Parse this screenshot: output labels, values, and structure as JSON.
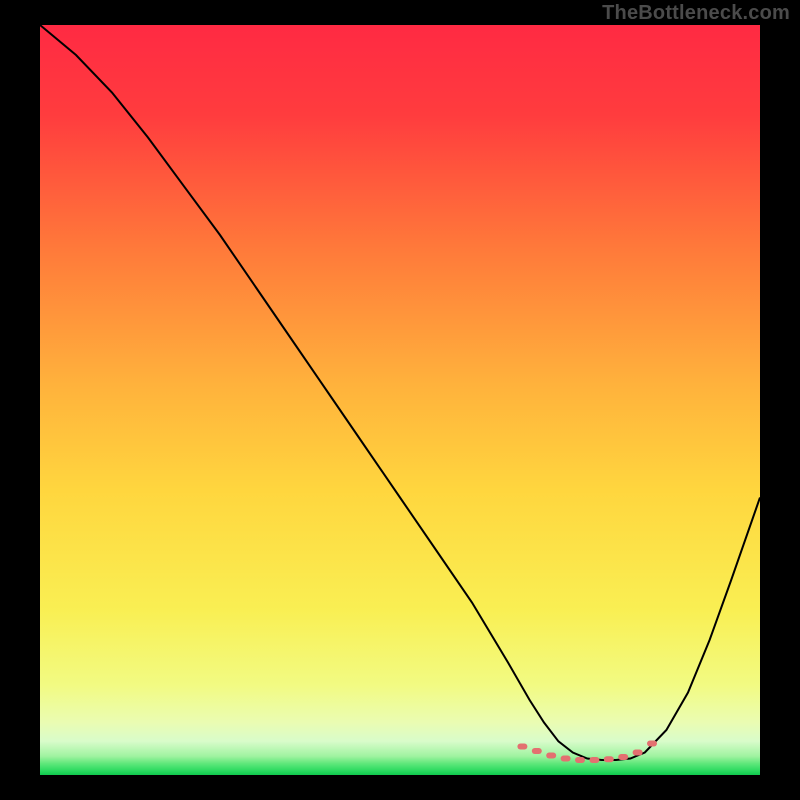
{
  "watermark": "TheBottleneck.com",
  "chart_data": {
    "type": "line",
    "title": "",
    "xlabel": "",
    "ylabel": "",
    "xlim": [
      0,
      100
    ],
    "ylim": [
      0,
      100
    ],
    "curve": {
      "name": "bottleneck-curve",
      "color": "#000000",
      "x": [
        0,
        5,
        10,
        15,
        20,
        25,
        30,
        35,
        40,
        45,
        50,
        55,
        60,
        65,
        68,
        70,
        72,
        74,
        76,
        78,
        80,
        82,
        84,
        87,
        90,
        93,
        96,
        100
      ],
      "y": [
        100,
        96,
        91,
        85,
        78.5,
        72,
        65,
        58,
        51,
        44,
        37,
        30,
        23,
        15,
        10,
        7,
        4.5,
        3,
        2.2,
        2,
        2,
        2.2,
        3,
        6,
        11,
        18,
        26,
        37
      ]
    },
    "marker_band": {
      "name": "optimal-range",
      "color": "#e37070",
      "x": [
        67,
        69,
        71,
        73,
        75,
        77,
        79,
        81,
        83,
        85
      ],
      "y": [
        3.8,
        3.2,
        2.6,
        2.2,
        2.0,
        2.0,
        2.1,
        2.4,
        3.0,
        4.2
      ]
    },
    "gradient_stops": [
      {
        "offset": 0.0,
        "color": "#ff2a43"
      },
      {
        "offset": 0.12,
        "color": "#ff3c3e"
      },
      {
        "offset": 0.3,
        "color": "#ff7a3a"
      },
      {
        "offset": 0.48,
        "color": "#ffb23c"
      },
      {
        "offset": 0.62,
        "color": "#ffd63e"
      },
      {
        "offset": 0.78,
        "color": "#f9ef53"
      },
      {
        "offset": 0.88,
        "color": "#f2fb82"
      },
      {
        "offset": 0.93,
        "color": "#eafcb2"
      },
      {
        "offset": 0.955,
        "color": "#d9fcca"
      },
      {
        "offset": 0.975,
        "color": "#9ff3a0"
      },
      {
        "offset": 0.985,
        "color": "#5de77a"
      },
      {
        "offset": 0.995,
        "color": "#27d85e"
      },
      {
        "offset": 1.0,
        "color": "#10c94e"
      }
    ]
  }
}
